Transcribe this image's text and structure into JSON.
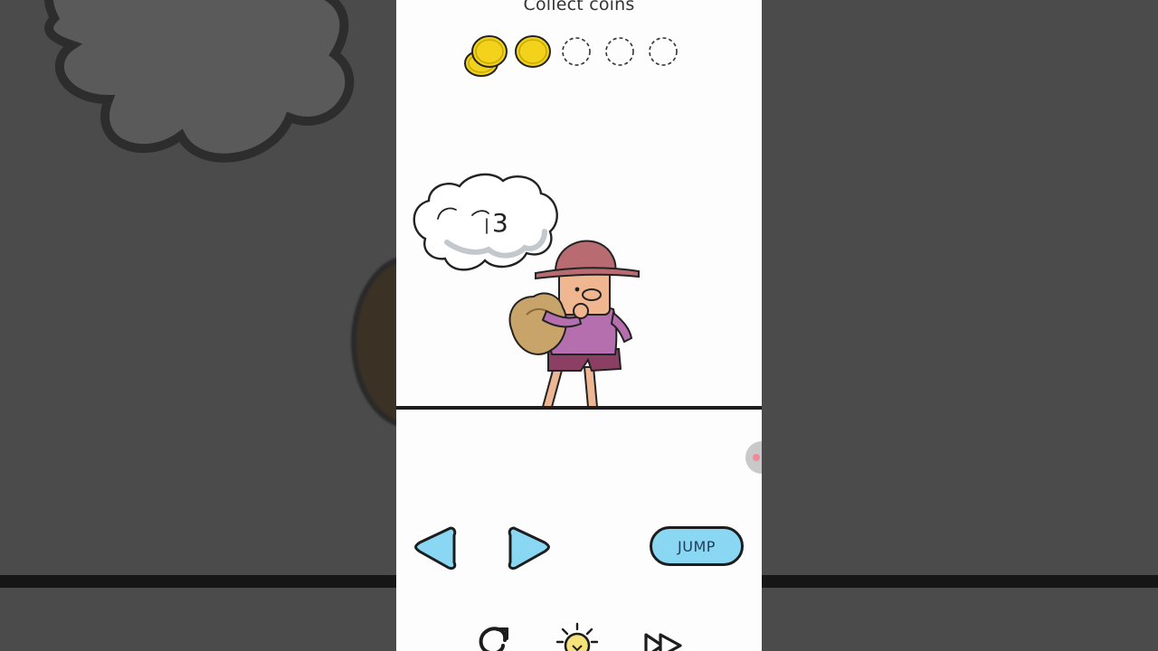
{
  "objective": {
    "text": "Collect coins"
  },
  "coins": {
    "collected": 2,
    "total": 5
  },
  "cloud": {
    "scribble": "3"
  },
  "controls": {
    "jump_label": "JUMP"
  },
  "toolbar": {
    "restart_icon": "restart-icon",
    "hint_icon": "lightbulb-icon",
    "skip_icon": "skip-forward-icon"
  },
  "colors": {
    "coin": "#f2d21b",
    "button": "#8ad7f3",
    "outline": "#1d1d1d",
    "shirt": "#b56fae",
    "hat": "#b86c72",
    "sack": "#c9a46a"
  }
}
